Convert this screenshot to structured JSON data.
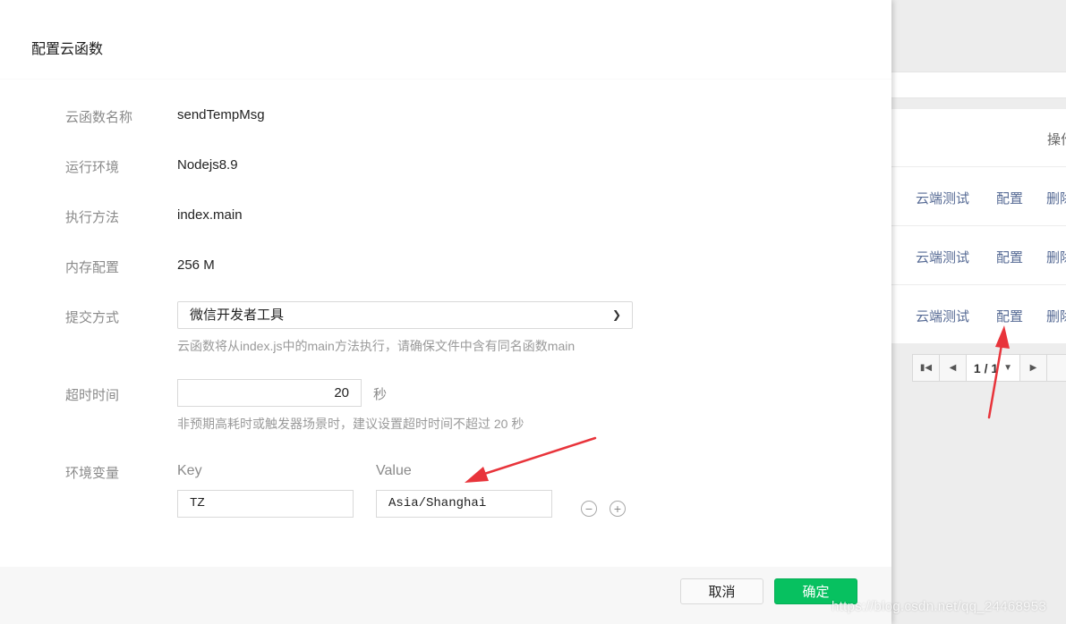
{
  "dialog": {
    "title": "配置云函数",
    "fields": {
      "name": {
        "label": "云函数名称",
        "value": "sendTempMsg"
      },
      "runtime": {
        "label": "运行环境",
        "value": "Nodejs8.9"
      },
      "handler": {
        "label": "执行方法",
        "value": "index.main"
      },
      "memory": {
        "label": "内存配置",
        "value": "256 M"
      },
      "submit": {
        "label": "提交方式",
        "selected": "微信开发者工具",
        "hint": "云函数将从index.js中的main方法执行，请确保文件中含有同名函数main"
      },
      "timeout": {
        "label": "超时时间",
        "value": "20",
        "unit": "秒",
        "hint": "非预期高耗时或触发器场景时，建议设置超时时间不超过 20 秒"
      },
      "env": {
        "label": "环境变量",
        "key_header": "Key",
        "value_header": "Value",
        "key": "TZ",
        "value": "Asia/Shanghai"
      }
    },
    "buttons": {
      "cancel": "取消",
      "ok": "确定"
    }
  },
  "background": {
    "column_header": "操作",
    "rows": [
      {
        "test": "云端测试",
        "config": "配置",
        "delete": "删除"
      },
      {
        "test": "云端测试",
        "config": "配置",
        "delete": "删除"
      },
      {
        "test": "云端测试",
        "config": "配置",
        "delete": "删除"
      }
    ],
    "pager": {
      "page": "1 / 1"
    }
  },
  "watermark": "https://blog.csdn.net/qq_24468953",
  "colors": {
    "accent": "#07c160",
    "link": "#576b95",
    "annotation_arrow": "#e8343b"
  },
  "icons": [
    "chevron-down-icon",
    "first-page-icon",
    "prev-page-icon",
    "next-page-icon",
    "minus-circle-icon",
    "plus-circle-icon"
  ]
}
